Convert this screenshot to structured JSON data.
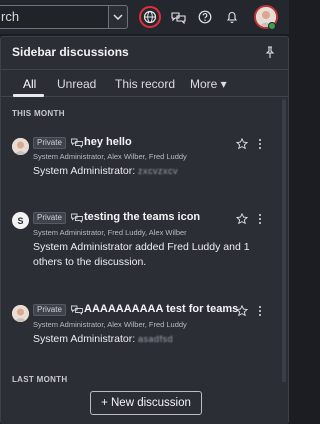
{
  "topbar": {
    "search_text": "rch",
    "icons": [
      "chevron-down-icon",
      "globe-icon",
      "chat-bubbles-icon",
      "help-icon",
      "bell-icon"
    ]
  },
  "panel": {
    "title": "Sidebar discussions",
    "tabs": [
      "All",
      "Unread",
      "This record",
      "More ▾"
    ],
    "active_tab": "All"
  },
  "sections": {
    "this_month": "THIS MONTH",
    "last_month": "LAST MONTH"
  },
  "discussions": [
    {
      "avatar": "",
      "tag": "Private",
      "title": "hey hello",
      "participants": "System Administrator, Alex Wilber, Fred Luddy",
      "message_prefix": "System Administrator:",
      "message_redacted": "zxcvzxcv"
    },
    {
      "avatar": "S",
      "tag": "Private",
      "title": "testing the teams icon",
      "participants": "System Administrator, Fred Luddy, Alex Wilber",
      "message_prefix": "System Administrator added Fred Luddy and 1 others to the discussion.",
      "message_redacted": ""
    },
    {
      "avatar": "",
      "tag": "Private",
      "title": "AAAAAAAAAA test for teams",
      "participants": "System Administrator, Alex Wilber, Fred Luddy",
      "message_prefix": "System Administrator:",
      "message_redacted": "asadfsd"
    }
  ],
  "footer": {
    "new_button_label": "+ New discussion"
  },
  "colors": {
    "background": "#1b1d22",
    "panel": "#2b2e35",
    "highlight_ring": "#e2303a",
    "presence": "#37a24b"
  }
}
